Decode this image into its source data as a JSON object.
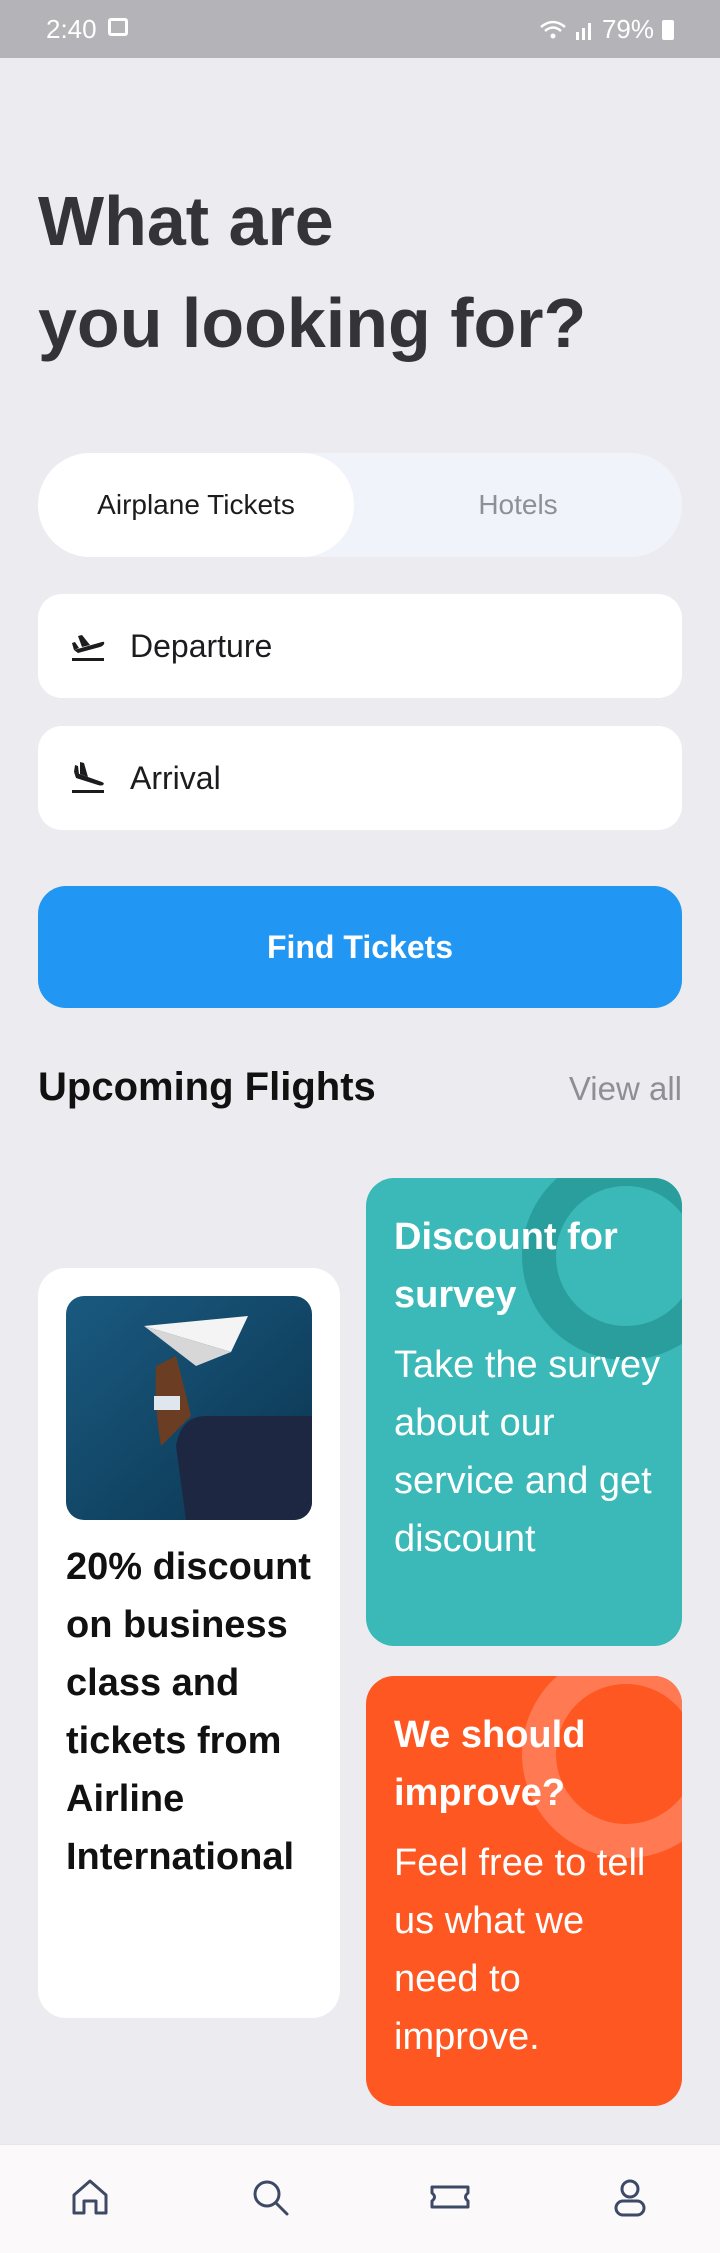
{
  "status_bar": {
    "time": "2:40",
    "battery": "79%"
  },
  "headline": {
    "line1": "What are",
    "line2": "you looking for?"
  },
  "tabs": [
    {
      "label": "Airplane Tickets",
      "active": true
    },
    {
      "label": "Hotels",
      "active": false
    }
  ],
  "fields": {
    "departure": {
      "label": "Departure",
      "icon": "plane-departure-icon"
    },
    "arrival": {
      "label": "Arrival",
      "icon": "plane-arrival-icon"
    }
  },
  "find_button": "Find Tickets",
  "section": {
    "title": "Upcoming Flights",
    "view_all": "View all"
  },
  "promo": {
    "text": "20% discount on business class and tickets from Airline International"
  },
  "cards": {
    "survey": {
      "title": "Discount for survey",
      "body": "Take the survey about our service and get discount",
      "color": "#3ab9b8"
    },
    "improve": {
      "title": "We should improve?",
      "body": "Feel free to tell us what we need to improve.",
      "color": "#fe5722"
    }
  },
  "nav": [
    "home-icon",
    "search-icon",
    "ticket-icon",
    "profile-icon"
  ],
  "colors": {
    "accent": "#2196f3",
    "background": "#ececf0"
  }
}
